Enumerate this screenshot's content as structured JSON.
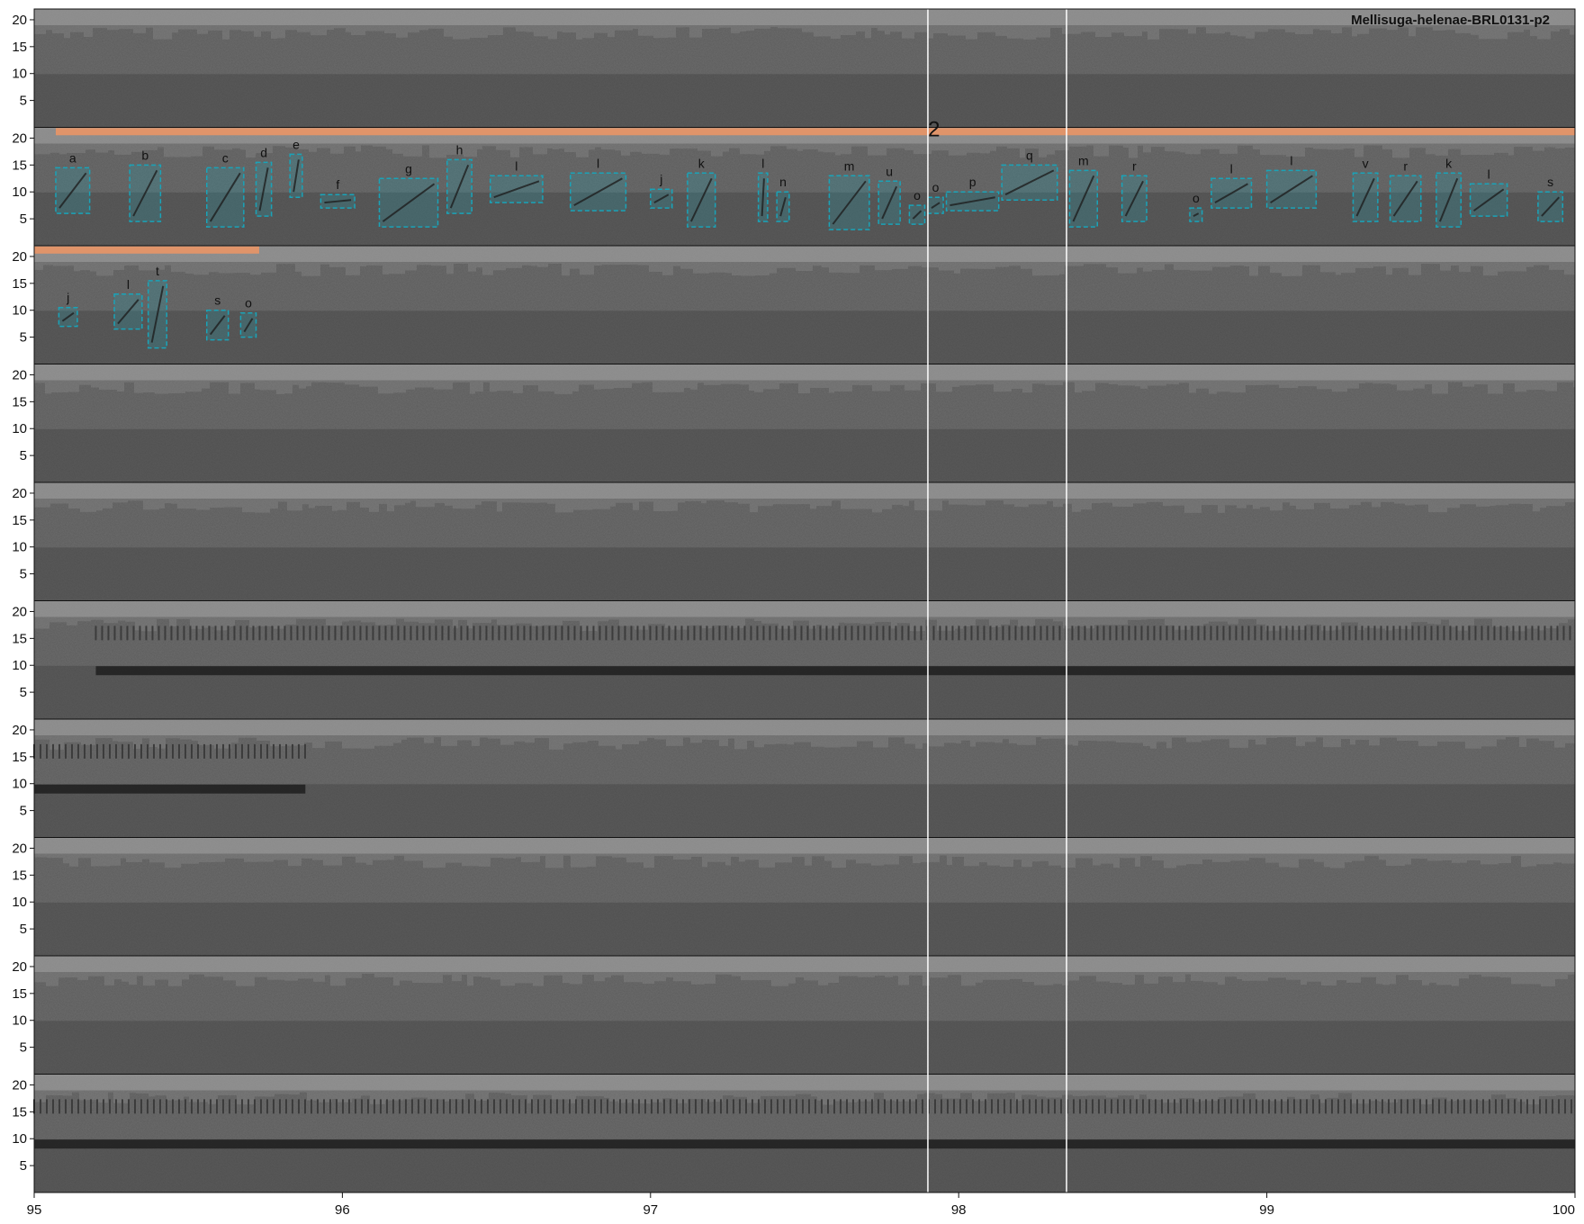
{
  "title": "Mellisuga-helenae-BRL0131-p2",
  "colors": {
    "background": "#ffffff",
    "spectrogram_base": "#5a5a5a",
    "noise_band": "#8a8a8a",
    "signal": "#1e1e1e",
    "syllable_box": "#1aa3b8",
    "song_bar": "#e0946a",
    "marker_line": "#ffffff"
  },
  "chart_data": {
    "type": "spectrogram",
    "title": "Mellisuga-helenae-BRL0131-p2",
    "xlim": [
      95,
      100
    ],
    "x_ticks": [
      "95",
      "96",
      "97",
      "98",
      "99",
      "100"
    ],
    "ylim": [
      0,
      22
    ],
    "y_ticks": [
      "5",
      "10",
      "15",
      "20"
    ],
    "row_count": 10,
    "markers_x": [
      97.9,
      98.35
    ],
    "song_label": "2",
    "song_bars": [
      {
        "row": 1,
        "x_start": 95.07,
        "x_end": 100
      },
      {
        "row": 2,
        "x_start": 95.0,
        "x_end": 95.73
      }
    ],
    "syllables": [
      {
        "row": 1,
        "label": "a",
        "x0": 95.07,
        "x1": 95.18,
        "y0": 6,
        "y1": 14.5
      },
      {
        "row": 1,
        "label": "b",
        "x0": 95.31,
        "x1": 95.41,
        "y0": 4.5,
        "y1": 15
      },
      {
        "row": 1,
        "label": "c",
        "x0": 95.56,
        "x1": 95.68,
        "y0": 3.5,
        "y1": 14.5
      },
      {
        "row": 1,
        "label": "d",
        "x0": 95.72,
        "x1": 95.77,
        "y0": 5.5,
        "y1": 15.5
      },
      {
        "row": 1,
        "label": "e",
        "x0": 95.83,
        "x1": 95.87,
        "y0": 9,
        "y1": 17
      },
      {
        "row": 1,
        "label": "f",
        "x0": 95.93,
        "x1": 96.04,
        "y0": 7,
        "y1": 9.5
      },
      {
        "row": 1,
        "label": "g",
        "x0": 96.12,
        "x1": 96.31,
        "y0": 3.5,
        "y1": 12.5
      },
      {
        "row": 1,
        "label": "h",
        "x0": 96.34,
        "x1": 96.42,
        "y0": 6,
        "y1": 16
      },
      {
        "row": 1,
        "label": "l",
        "x0": 96.48,
        "x1": 96.65,
        "y0": 8,
        "y1": 13
      },
      {
        "row": 1,
        "label": "l",
        "x0": 96.74,
        "x1": 96.92,
        "y0": 6.5,
        "y1": 13.5
      },
      {
        "row": 1,
        "label": "j",
        "x0": 97.0,
        "x1": 97.07,
        "y0": 7,
        "y1": 10.5
      },
      {
        "row": 1,
        "label": "k",
        "x0": 97.12,
        "x1": 97.21,
        "y0": 3.5,
        "y1": 13.5
      },
      {
        "row": 1,
        "label": "l",
        "x0": 97.35,
        "x1": 97.38,
        "y0": 4.5,
        "y1": 13.5
      },
      {
        "row": 1,
        "label": "n",
        "x0": 97.41,
        "x1": 97.45,
        "y0": 4.5,
        "y1": 10
      },
      {
        "row": 1,
        "label": "m",
        "x0": 97.58,
        "x1": 97.71,
        "y0": 3,
        "y1": 13
      },
      {
        "row": 1,
        "label": "u",
        "x0": 97.74,
        "x1": 97.81,
        "y0": 4,
        "y1": 12
      },
      {
        "row": 1,
        "label": "o",
        "x0": 97.84,
        "x1": 97.89,
        "y0": 4,
        "y1": 7.5
      },
      {
        "row": 1,
        "label": "o",
        "x0": 97.9,
        "x1": 97.95,
        "y0": 6,
        "y1": 9
      },
      {
        "row": 1,
        "label": "p",
        "x0": 97.96,
        "x1": 98.13,
        "y0": 6.5,
        "y1": 10
      },
      {
        "row": 1,
        "label": "q",
        "x0": 98.14,
        "x1": 98.32,
        "y0": 8.5,
        "y1": 15
      },
      {
        "row": 1,
        "label": "m",
        "x0": 98.36,
        "x1": 98.45,
        "y0": 3.5,
        "y1": 14
      },
      {
        "row": 1,
        "label": "r",
        "x0": 98.53,
        "x1": 98.61,
        "y0": 4.5,
        "y1": 13
      },
      {
        "row": 1,
        "label": "o",
        "x0": 98.75,
        "x1": 98.79,
        "y0": 4.5,
        "y1": 7
      },
      {
        "row": 1,
        "label": "l",
        "x0": 98.82,
        "x1": 98.95,
        "y0": 7,
        "y1": 12.5
      },
      {
        "row": 1,
        "label": "l",
        "x0": 99.0,
        "x1": 99.16,
        "y0": 7,
        "y1": 14
      },
      {
        "row": 1,
        "label": "v",
        "x0": 99.28,
        "x1": 99.36,
        "y0": 4.5,
        "y1": 13.5
      },
      {
        "row": 1,
        "label": "r",
        "x0": 99.4,
        "x1": 99.5,
        "y0": 4.5,
        "y1": 13
      },
      {
        "row": 1,
        "label": "k",
        "x0": 99.55,
        "x1": 99.63,
        "y0": 3.5,
        "y1": 13.5
      },
      {
        "row": 1,
        "label": "l",
        "x0": 99.66,
        "x1": 99.78,
        "y0": 5.5,
        "y1": 11.5
      },
      {
        "row": 1,
        "label": "s",
        "x0": 99.88,
        "x1": 99.96,
        "y0": 4.5,
        "y1": 10
      },
      {
        "row": 2,
        "label": "j",
        "x0": 95.08,
        "x1": 95.14,
        "y0": 7,
        "y1": 10.5
      },
      {
        "row": 2,
        "label": "l",
        "x0": 95.26,
        "x1": 95.35,
        "y0": 6.5,
        "y1": 13
      },
      {
        "row": 2,
        "label": "t",
        "x0": 95.37,
        "x1": 95.43,
        "y0": 3,
        "y1": 15.5
      },
      {
        "row": 2,
        "label": "s",
        "x0": 95.56,
        "x1": 95.63,
        "y0": 4.5,
        "y1": 10
      },
      {
        "row": 2,
        "label": "o",
        "x0": 95.67,
        "x1": 95.72,
        "y0": 5,
        "y1": 9.5
      }
    ],
    "tonal_bands": [
      {
        "row": 5,
        "x_start": 95.2,
        "x_end": 100,
        "freq": 9
      },
      {
        "row": 6,
        "x_start": 95.0,
        "x_end": 95.88,
        "freq": 9
      },
      {
        "row": 9,
        "x_start": 95.0,
        "x_end": 100,
        "freq": 9
      }
    ]
  }
}
